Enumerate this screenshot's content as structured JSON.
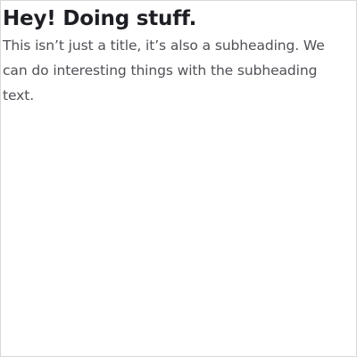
{
  "header": {
    "title": "Hey! Doing stuff.",
    "subheading": "This isn’t just a title, it’s also a subheading. We can do interesting things with the subheading text."
  }
}
